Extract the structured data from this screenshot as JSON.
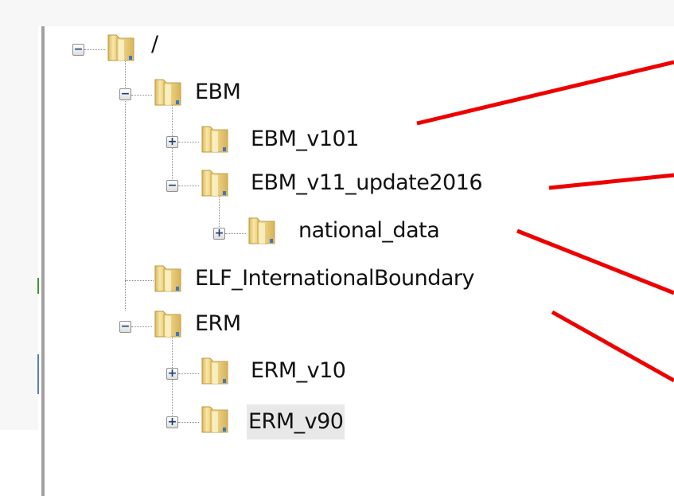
{
  "tree": {
    "root": {
      "label": "/",
      "expanded": true
    },
    "nodes": [
      {
        "label": "EBM",
        "expanded": true
      },
      {
        "label": "EBM_v101",
        "expanded": false
      },
      {
        "label": "EBM_v11_update2016",
        "expanded": true
      },
      {
        "label": "national_data",
        "expanded": false
      },
      {
        "label": "ELF_InternationalBoundary",
        "expanded": null
      },
      {
        "label": "ERM",
        "expanded": true
      },
      {
        "label": "ERM_v10",
        "expanded": false
      },
      {
        "label": "ERM_v90",
        "expanded": false,
        "selected": true
      }
    ]
  },
  "glyphs": {
    "expand": "+",
    "collapse": "−"
  },
  "colors": {
    "callout": "#ee0000",
    "folder": "#f2d77c",
    "tree_lines": "#8a8a8a"
  }
}
